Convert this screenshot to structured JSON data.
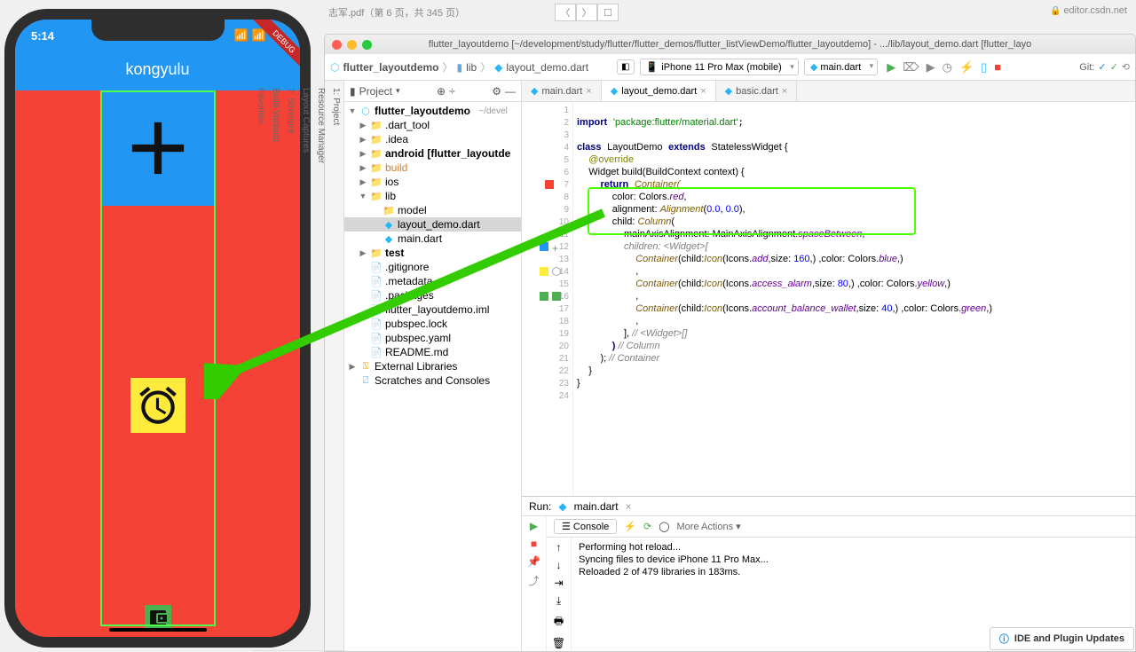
{
  "bg": {
    "tab_title": "志军.pdf（第 6 页，共 345 页）",
    "url": "editor.csdn.net"
  },
  "phone": {
    "time": "5:14",
    "title": "kongyulu",
    "debug": "DEBUG"
  },
  "ide": {
    "title": "flutter_layoutdemo [~/development/study/flutter/flutter_demos/flutter_listViewDemo/flutter_layoutdemo] - .../lib/layout_demo.dart [flutter_layo",
    "breadcrumb": [
      "flutter_layoutdemo",
      "lib",
      "layout_demo.dart"
    ],
    "device": "iPhone 11 Pro Max (mobile)",
    "run_config": "main.dart",
    "git_label": "Git:"
  },
  "project": {
    "header": "Project",
    "root": "flutter_layoutdemo",
    "root_path": "~/devel",
    "items": {
      "dart_tool": ".dart_tool",
      "idea": ".idea",
      "android": "android [flutter_layoutde",
      "build": "build",
      "ios": "ios",
      "lib": "lib",
      "model": "model",
      "layout_demo": "layout_demo.dart",
      "main": "main.dart",
      "test": "test",
      "gitignore": ".gitignore",
      "metadata": ".metadata",
      "packages": ".packages",
      "iml": "flutter_layoutdemo.iml",
      "pubspec_lock": "pubspec.lock",
      "pubspec_yaml": "pubspec.yaml",
      "readme": "README.md",
      "ext_lib": "External Libraries",
      "scratches": "Scratches and Consoles"
    }
  },
  "tabs": {
    "t1": "main.dart",
    "t2": "layout_demo.dart",
    "t3": "basic.dart"
  },
  "code": {
    "l1a": "import",
    "l1b": "'package:flutter/material.dart'",
    "l3a": "class",
    "l3b": "LayoutDemo",
    "l3c": "extends",
    "l3d": "StatelessWidget {",
    "l4": "@override",
    "l5a": "Widget build(BuildContext context) {",
    "l6a": "return",
    "l6b": "Container(",
    "l7a": "color: Colors.",
    "l7b": "red",
    "l7c": ",",
    "l8a": "alignment: ",
    "l8b": "Alignment",
    "l8c": "(",
    "l8d": "0.0",
    "l8e": ", ",
    "l8f": "0.0",
    "l8g": "),",
    "l9a": "child: ",
    "l9b": "Column",
    "l9c": "(",
    "l10a": "mainAxisAlignment: MainAxisAlignment.",
    "l10b": "spaceBetween",
    "l10c": ",",
    "l11a": "children: <Widget>[",
    "l12a": "Container",
    "l12b": "(child:",
    "l12c": "Icon",
    "l12d": "(Icons.",
    "l12e": "add",
    "l12f": ",size: ",
    "l12g": "160",
    "l12h": ",) ,color: Colors.",
    "l12i": "blue",
    "l12j": ",)",
    "l13": ",",
    "l14a": "Container",
    "l14b": "(child:",
    "l14c": "Icon",
    "l14d": "(Icons.",
    "l14e": "access_alarm",
    "l14f": ",size: ",
    "l14g": "80",
    "l14h": ",) ,color: Colors.",
    "l14i": "yellow",
    "l14j": ",)",
    "l15": ",",
    "l16a": "Container",
    "l16b": "(child:",
    "l16c": "Icon",
    "l16d": "(Icons.",
    "l16e": "account_balance_wallet",
    "l16f": ",size: ",
    "l16g": "40",
    "l16h": ",) ,color: Colors.",
    "l16i": "green",
    "l16j": ",)",
    "l17": ",",
    "l18a": "], ",
    "l18b": "// <Widget>[]",
    "l19a": ") ",
    "l19b": "// Column",
    "l20a": "); ",
    "l20b": "// Container",
    "l21": "}",
    "l22": "}"
  },
  "run": {
    "label": "Run:",
    "config": "main.dart",
    "console_btn": "Console",
    "more": "More Actions",
    "out1": "Performing hot reload...",
    "out2": "Syncing files to device iPhone 11 Pro Max...",
    "out3": "Reloaded 2 of 479 libraries in 183ms."
  },
  "banner": "IDE and Plugin Updates",
  "rails": {
    "project": "1: Project",
    "resmgr": "Resource Manager",
    "layoutcap": "Layout Captures",
    "structure": "7: Structure",
    "buildvar": "Build Variants",
    "favorites": "Favorites"
  }
}
